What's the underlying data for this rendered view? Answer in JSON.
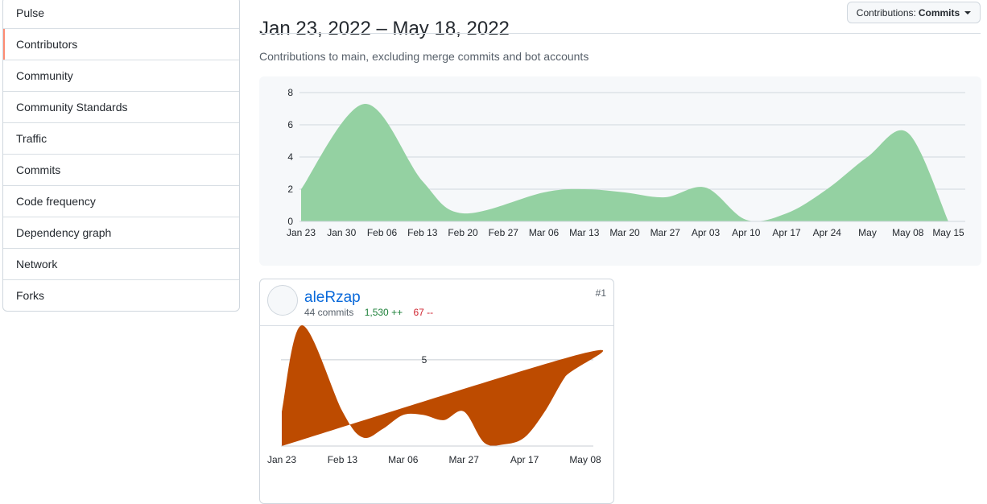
{
  "sidebar": {
    "items": [
      {
        "label": "Pulse"
      },
      {
        "label": "Contributors",
        "active": true
      },
      {
        "label": "Community"
      },
      {
        "label": "Community Standards"
      },
      {
        "label": "Traffic"
      },
      {
        "label": "Commits"
      },
      {
        "label": "Code frequency"
      },
      {
        "label": "Dependency graph"
      },
      {
        "label": "Network"
      },
      {
        "label": "Forks"
      }
    ]
  },
  "header": {
    "date_range": "Jan 23, 2022 – May 18, 2022",
    "contrib_button": {
      "prefix": "Contributions:",
      "value": "Commits"
    },
    "subtitle": "Contributions to main, excluding merge commits and bot accounts"
  },
  "colors": {
    "main_area": "#94d1a2",
    "contributor_area": "#bd4b00",
    "active_accent": "#fd8c73",
    "link": "#0969da"
  },
  "chart_data": [
    {
      "type": "area",
      "title": "",
      "x_tick_labels": [
        "Jan 23",
        "Jan 30",
        "Feb 06",
        "Feb 13",
        "Feb 20",
        "Feb 27",
        "Mar 06",
        "Mar 13",
        "Mar 20",
        "Mar 27",
        "Apr 03",
        "Apr 10",
        "Apr 17",
        "Apr 24",
        "May",
        "May 08",
        "May 15"
      ],
      "y_ticks": [
        0,
        2,
        4,
        6,
        8
      ],
      "ylim": [
        0,
        8
      ],
      "grid": true,
      "series": [
        {
          "x": [
            "Jan 23",
            "Feb 03",
            "Feb 13",
            "Feb 20",
            "Mar 06",
            "Mar 13",
            "Mar 20",
            "Mar 27",
            "Apr 03",
            "Apr 10",
            "Apr 17",
            "Apr 24",
            "May",
            "May 08",
            "May 15"
          ],
          "values": [
            2,
            7.3,
            2.5,
            0.5,
            1.8,
            2,
            1.8,
            1.5,
            2.1,
            0.1,
            0.5,
            2,
            4,
            5.5,
            0
          ]
        }
      ]
    },
    {
      "type": "area",
      "title": "",
      "x_tick_labels": [
        "Jan 23",
        "Feb 13",
        "Mar 06",
        "Mar 27",
        "Apr 17",
        "May 08"
      ],
      "y_ticks": [
        5
      ],
      "ylim": [
        0,
        7
      ],
      "grid": true,
      "series": [
        {
          "x": [
            "Jan 23",
            "Jan 30",
            "Feb 13",
            "Feb 20",
            "Feb 27",
            "Mar 06",
            "Mar 13",
            "Mar 20",
            "Mar 27",
            "Apr 03",
            "Apr 10",
            "Apr 17",
            "Apr 24",
            "May",
            "May 08",
            "May 15"
          ],
          "values": [
            2,
            7,
            2,
            0.5,
            1,
            1.8,
            1.8,
            1.5,
            2,
            0.2,
            0.1,
            0.5,
            2,
            4,
            5.4,
            0
          ]
        }
      ]
    }
  ],
  "contributor": {
    "username": "aleRzap",
    "commits": "44 commits",
    "additions": "1,530 ++",
    "deletions": "67 --",
    "rank": "#1"
  }
}
